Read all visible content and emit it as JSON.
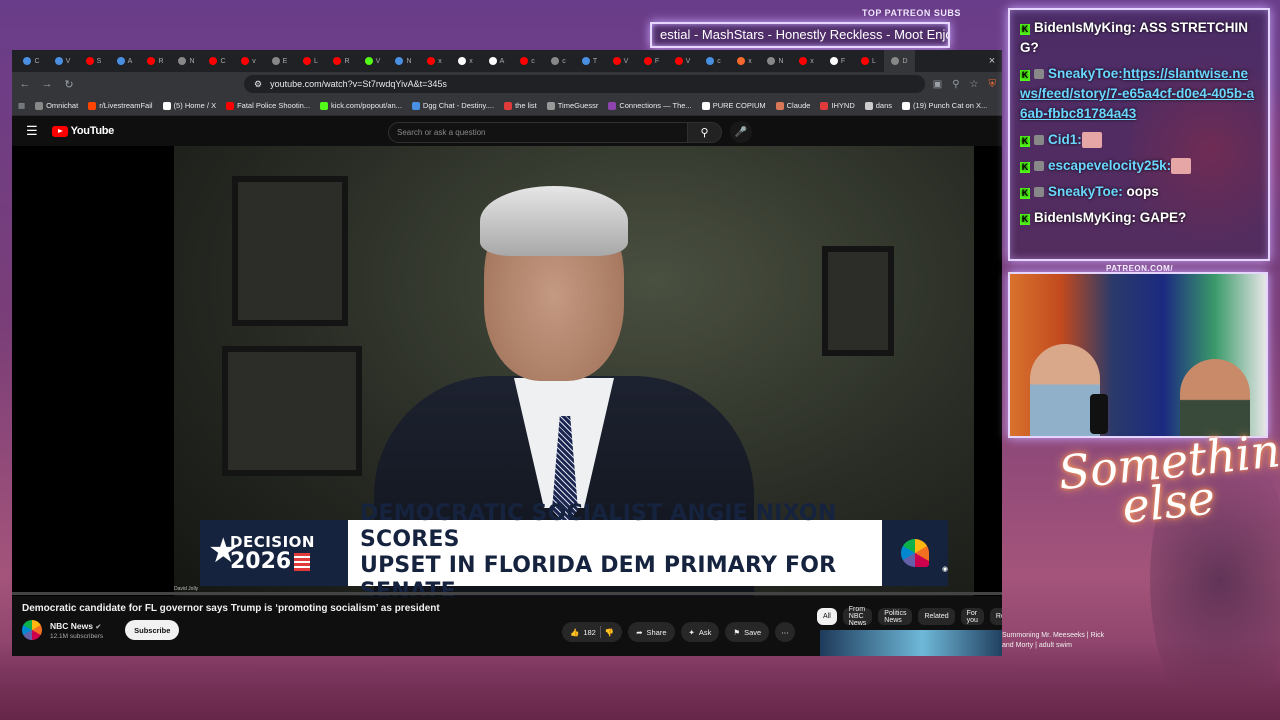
{
  "overlay": {
    "patreon_label": "TOP PATREON SUBS",
    "marquee_text": "estial - MashStars - Honestly Reckless - Moot Enjoyer - Fc",
    "cam_label": "PATREON.COM/",
    "signature_line1": "Something",
    "signature_line2": "else"
  },
  "browser": {
    "url": "youtube.com/watch?v=St7rwdqYivA&t=345s",
    "tabs": [
      "C",
      "V",
      "S",
      "A",
      "R",
      "N",
      "C",
      "v",
      "E",
      "L",
      "R",
      "V",
      "N",
      "x",
      "x",
      "A",
      "c",
      "c",
      "T",
      "V",
      "F",
      "V",
      "c",
      "x",
      "N",
      "x",
      "F",
      "L",
      "D"
    ],
    "bookmarks": [
      {
        "label": "Omnichat",
        "color": "#888"
      },
      {
        "label": "r/LivestreamFail",
        "color": "#ff4500"
      },
      {
        "label": "(5) Home / X",
        "color": "#fff"
      },
      {
        "label": "Fatal Police Shootin...",
        "color": "#ff0000"
      },
      {
        "label": "kick.com/popout/an...",
        "color": "#53fc18"
      },
      {
        "label": "Dgg Chat - Destiny....",
        "color": "#4a90e2"
      },
      {
        "label": "the list",
        "color": "#e03a3a"
      },
      {
        "label": "TimeGuessr",
        "color": "#999"
      },
      {
        "label": "Connections — The...",
        "color": "#8e44ad"
      },
      {
        "label": "PURE COPIUM",
        "color": "#fff"
      },
      {
        "label": "Claude",
        "color": "#d97757"
      },
      {
        "label": "IHYND",
        "color": "#e03a3a"
      },
      {
        "label": "dans",
        "color": "#ccc"
      },
      {
        "label": "(19) Punch Cat on X...",
        "color": "#fff"
      }
    ]
  },
  "youtube": {
    "logo_text": "YouTube",
    "search_placeholder": "Search or ask a question",
    "lower_third": {
      "decision_top": "DECISION",
      "decision_year": "2026",
      "headline_line1": "DEMOCRATIC SOCIALIST ANGIE NIXON SCORES",
      "headline_line2": "UPSET IN FLORIDA DEM PRIMARY FOR SENATE"
    },
    "caption_credit": "David Jolly",
    "progress_fraction": 0.0,
    "video_title": "Democratic candidate for FL governor says Trump is ‘promoting socialism’ as president",
    "channel": {
      "name": "NBC News",
      "subscribers": "12.1M subscribers",
      "subscribe_label": "Subscribe"
    },
    "actions": {
      "like_count": "182",
      "share_label": "Share",
      "ask_label": "Ask",
      "save_label": "Save"
    },
    "chips": [
      "All",
      "From NBC News",
      "Politics News",
      "Related",
      "For you",
      "Recent"
    ],
    "recommendation_title": "Summoning Mr. Meeseeks | Rick and Morty | adult swim"
  },
  "chat": {
    "messages": [
      {
        "user": "BidenIsMyKing:",
        "text": " ASS STRETCHING?",
        "badge": false
      },
      {
        "user": "SneakyToe:",
        "text": "https://slantwise.news/feed/story/7-e65a4cf-d0e4-405b-a6ab-fbbc81784a43",
        "badge": true,
        "is_link": true
      },
      {
        "user": "Cid1:",
        "text": "",
        "badge": true,
        "emote": true
      },
      {
        "user": "escapevelocity25k:",
        "text": "",
        "badge": true,
        "emote": true
      },
      {
        "user": "SneakyToe:",
        "text": " oops",
        "badge": true
      },
      {
        "user": "BidenIsMyKing:",
        "text": " GAPE?",
        "badge": false
      }
    ]
  }
}
